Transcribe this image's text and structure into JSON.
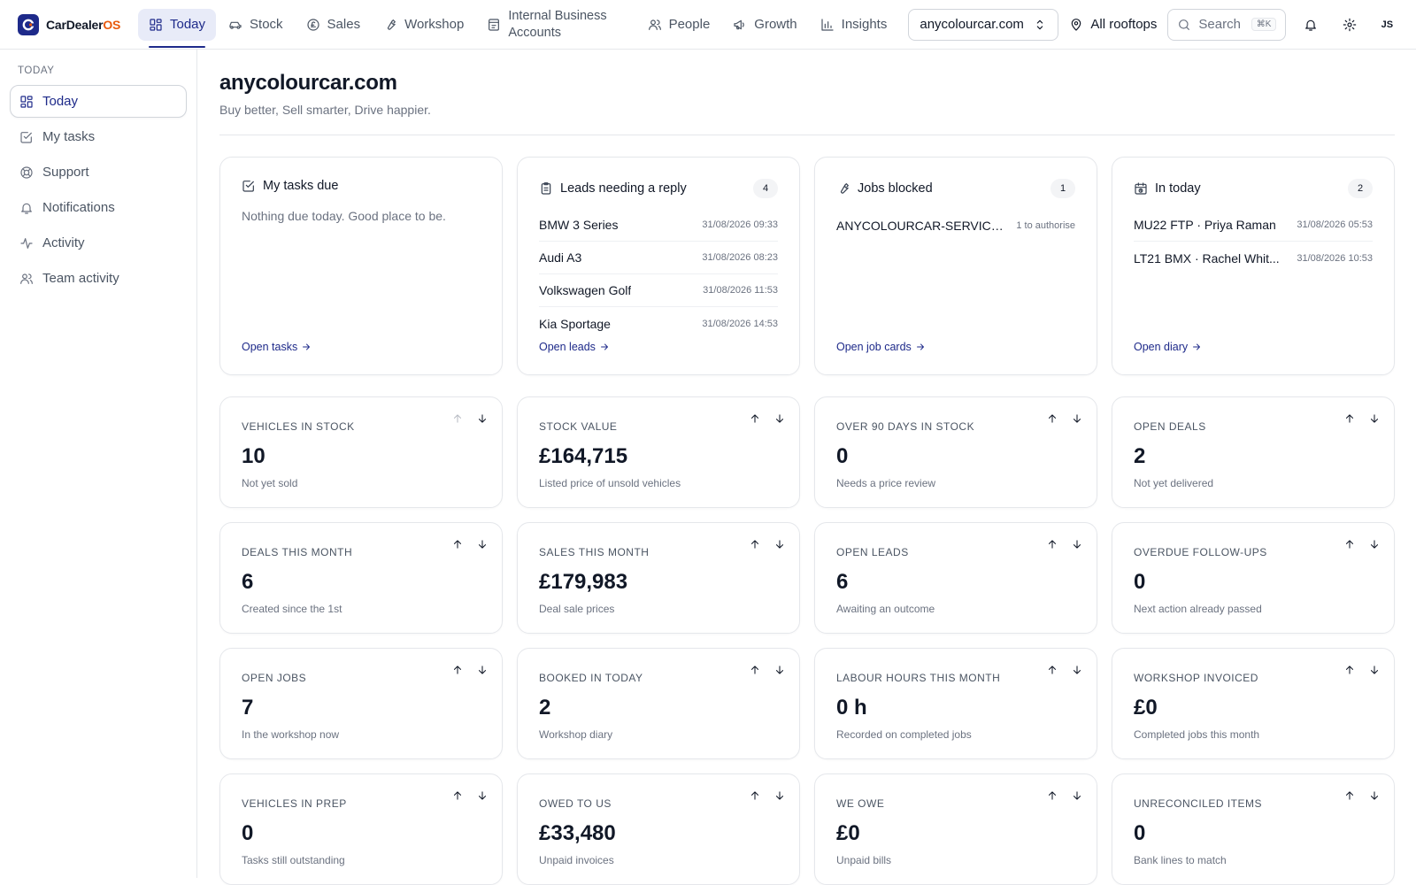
{
  "brand": {
    "name": "CarDealer",
    "accent": "OS",
    "accent_color": "#e8590c",
    "primary_color": "#1e2a8a"
  },
  "nav": {
    "tabs": [
      {
        "label": "Today",
        "icon": "dashboard-icon",
        "active": true
      },
      {
        "label": "Stock",
        "icon": "car-icon"
      },
      {
        "label": "Sales",
        "icon": "pound-coin-icon"
      },
      {
        "label": "Workshop",
        "icon": "wrench-icon"
      },
      {
        "label": "Internal Business",
        "label2": "Accounts",
        "icon": "receipt-icon"
      },
      {
        "label": "People",
        "icon": "users-icon"
      },
      {
        "label": "Growth",
        "icon": "megaphone-icon"
      },
      {
        "label": "Insights",
        "icon": "bar-chart-icon"
      }
    ],
    "site": "anycolourcar.com",
    "rooftops": "All rooftops",
    "search_placeholder": "Search",
    "search_shortcut": "⌘K",
    "user_initials": "JS"
  },
  "sidebar": {
    "heading": "TODAY",
    "items": [
      {
        "label": "Today",
        "icon": "dashboard-icon",
        "active": true
      },
      {
        "label": "My tasks",
        "icon": "check-square-icon"
      },
      {
        "label": "Support",
        "icon": "lifebuoy-icon"
      },
      {
        "label": "Notifications",
        "icon": "bell-icon"
      },
      {
        "label": "Activity",
        "icon": "activity-icon"
      },
      {
        "label": "Team activity",
        "icon": "users-icon"
      }
    ]
  },
  "page": {
    "title": "anycolourcar.com",
    "subtitle": "Buy better, Sell smarter, Drive happier."
  },
  "panels": {
    "tasks": {
      "title": "My tasks due",
      "empty": "Nothing due today. Good place to be.",
      "link": "Open tasks"
    },
    "leads": {
      "title": "Leads needing a reply",
      "count": "4",
      "link": "Open leads",
      "rows": [
        {
          "name": "BMW 3 Series",
          "meta": "31/08/2026 09:33"
        },
        {
          "name": "Audi A3",
          "meta": "31/08/2026 08:23"
        },
        {
          "name": "Volkswagen Golf",
          "meta": "31/08/2026 11:53"
        },
        {
          "name": "Kia Sportage",
          "meta": "31/08/2026 14:53"
        }
      ]
    },
    "jobs": {
      "title": "Jobs blocked",
      "count": "1",
      "link": "Open job cards",
      "rows": [
        {
          "name": "ANYCOLOURCAR-SERVICE...",
          "meta": "1 to authorise"
        }
      ]
    },
    "diary": {
      "title": "In today",
      "count": "2",
      "link": "Open diary",
      "rows": [
        {
          "name": "MU22 FTP · Priya Raman",
          "meta": "31/08/2026 05:53"
        },
        {
          "name": "LT21 BMX · Rachel Whit...",
          "meta": "31/08/2026 10:53"
        }
      ]
    }
  },
  "stats": [
    {
      "label": "VEHICLES IN STOCK",
      "value": "10",
      "sub": "Not yet sold",
      "up_disabled": true
    },
    {
      "label": "STOCK VALUE",
      "value": "£164,715",
      "sub": "Listed price of unsold vehicles"
    },
    {
      "label": "OVER 90 DAYS IN STOCK",
      "value": "0",
      "sub": "Needs a price review"
    },
    {
      "label": "OPEN DEALS",
      "value": "2",
      "sub": "Not yet delivered"
    },
    {
      "label": "DEALS THIS MONTH",
      "value": "6",
      "sub": "Created since the 1st"
    },
    {
      "label": "SALES THIS MONTH",
      "value": "£179,983",
      "sub": "Deal sale prices"
    },
    {
      "label": "OPEN LEADS",
      "value": "6",
      "sub": "Awaiting an outcome"
    },
    {
      "label": "OVERDUE FOLLOW-UPS",
      "value": "0",
      "sub": "Next action already passed"
    },
    {
      "label": "OPEN JOBS",
      "value": "7",
      "sub": "In the workshop now"
    },
    {
      "label": "BOOKED IN TODAY",
      "value": "2",
      "sub": "Workshop diary"
    },
    {
      "label": "LABOUR HOURS THIS MONTH",
      "value": "0 h",
      "sub": "Recorded on completed jobs"
    },
    {
      "label": "WORKSHOP INVOICED",
      "value": "£0",
      "sub": "Completed jobs this month"
    },
    {
      "label": "VEHICLES IN PREP",
      "value": "0",
      "sub": "Tasks still outstanding"
    },
    {
      "label": "OWED TO US",
      "value": "£33,480",
      "sub": "Unpaid invoices"
    },
    {
      "label": "WE OWE",
      "value": "£0",
      "sub": "Unpaid bills"
    },
    {
      "label": "UNRECONCILED ITEMS",
      "value": "0",
      "sub": "Bank lines to match"
    }
  ]
}
